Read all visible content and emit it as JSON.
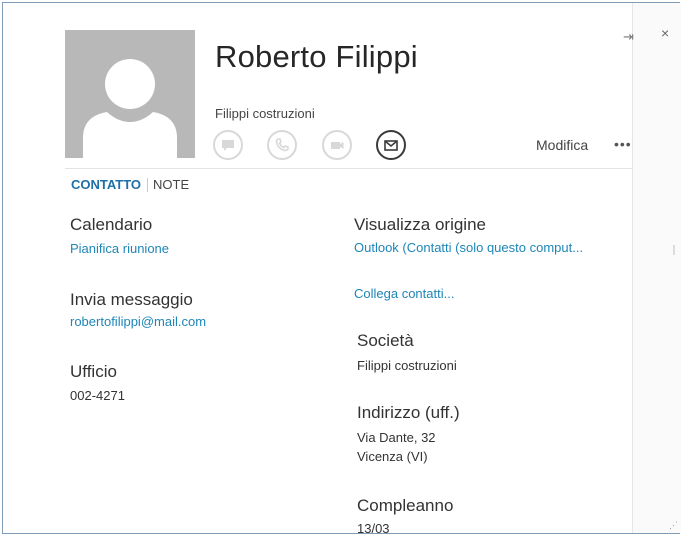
{
  "contact": {
    "name": "Roberto Filippi",
    "company": "Filippi costruzioni"
  },
  "header": {
    "edit_label": "Modifica",
    "more_label": "•••",
    "pin_glyph": "⇥",
    "close_glyph": "×"
  },
  "action_icons": [
    "chat-icon",
    "phone-icon",
    "video-icon",
    "mail-icon"
  ],
  "tabs": [
    {
      "label": "CONTATTO",
      "active": true
    },
    {
      "label": "NOTE",
      "active": false
    }
  ],
  "left_column": {
    "calendar_label": "Calendario",
    "calendar_link": "Pianifica riunione",
    "message_label": "Invia messaggio",
    "email": "robertofilippi@mail.com",
    "office_label": "Ufficio",
    "office_phone": "002-4271"
  },
  "right_column": {
    "source_label": "Visualizza origine",
    "source_link": "Outlook (Contatti (solo questo comput...",
    "link_contacts": "Collega contatti...",
    "company_label": "Società",
    "company_value": "Filippi costruzioni",
    "address_label": "Indirizzo (uff.)",
    "address_line1": "Via Dante, 32",
    "address_line2": "Vicenza  (VI)",
    "birthday_label": "Compleanno",
    "birthday_value": "13/03"
  },
  "colors": {
    "accent": "#1e6fa8",
    "link": "#1e86b8",
    "avatar_bg": "#b8b8b8",
    "disabled_icon": "#d8d8d8"
  }
}
